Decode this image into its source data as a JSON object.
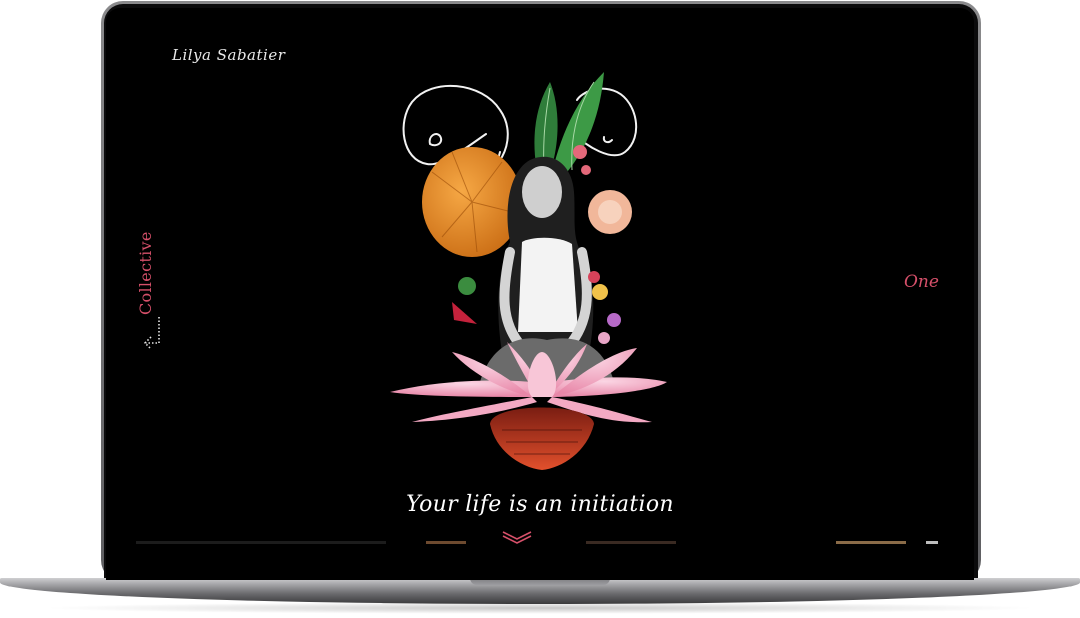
{
  "site": {
    "logo": "Lilya Sabatier",
    "nav_left": "Collective",
    "nav_right": "One",
    "tagline": "Your life is an initiation"
  },
  "icons": {
    "nav_left_arrow": "dotted-arrow-left-icon",
    "scroll_down": "chevron-down-icon"
  },
  "colors": {
    "background": "#000000",
    "accent": "#d6506a",
    "text": "#ffffff"
  }
}
